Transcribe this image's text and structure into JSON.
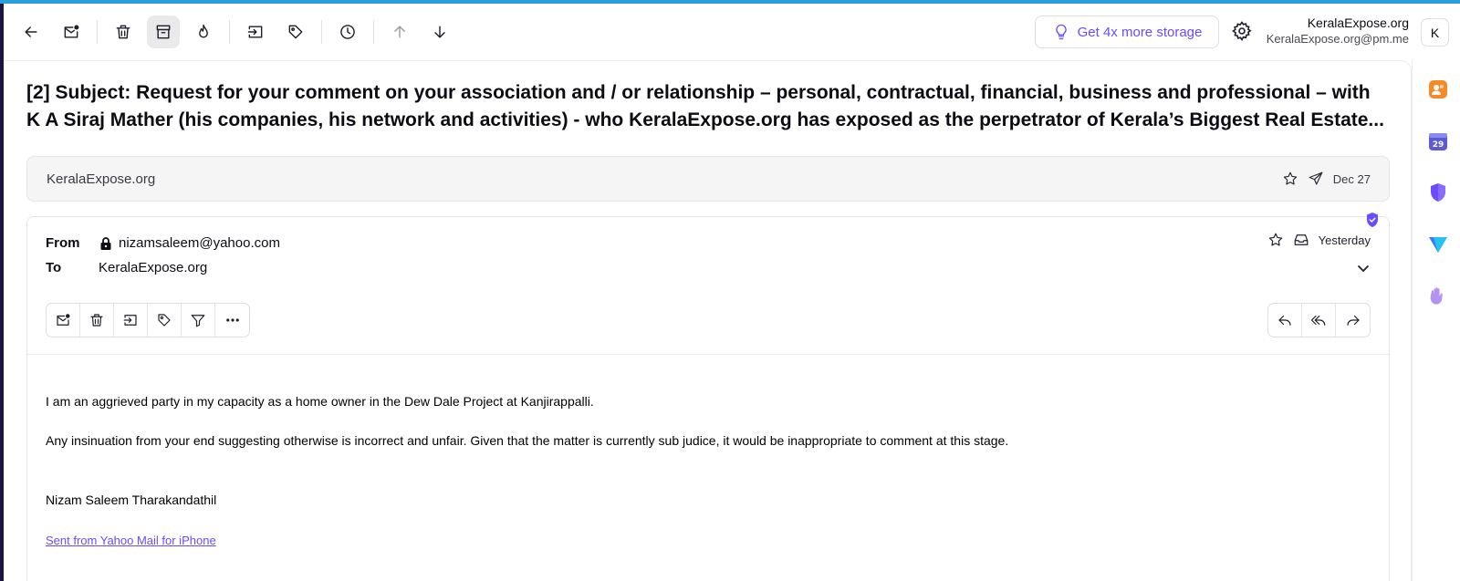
{
  "account": {
    "name": "KeralaExpose.org",
    "email": "KeralaExpose.org@pm.me",
    "avatar_initial": "K"
  },
  "toolbar": {
    "storage_label": "Get 4x more storage",
    "buttons": [
      "back-arrow-icon",
      "mark-unread-icon",
      "trash-icon",
      "archive-icon",
      "spam-flame-icon",
      "move-to-folder-icon",
      "label-tag-icon",
      "snooze-clock-icon",
      "previous-arrow-icon",
      "next-arrow-icon"
    ]
  },
  "subject": "[2] Subject: Request for your comment on your association and / or relationship – personal, contractual, financial, business and professional – with K A Siraj Mather (his companies, his network and activities) - who KeralaExpose.org has exposed as the perpetrator of Kerala’s Biggest Real Estate...",
  "collapsed_message": {
    "sender": "KeralaExpose.org",
    "date": "Dec 27"
  },
  "message": {
    "from_label": "From",
    "from": "nizamsaleem@yahoo.com",
    "to_label": "To",
    "to": "KeralaExpose.org",
    "date": "Yesterday",
    "body": [
      "I am an aggrieved party in my capacity as a home owner in the Dew Dale Project at Kanjirappalli.",
      "Any insinuation from your end suggesting otherwise is incorrect and unfair. Given that the matter is currently sub judice, it would be inappropriate to comment at this stage."
    ],
    "signature": "Nizam Saleem Tharakandathil",
    "sent_from_link": "Sent from Yahoo Mail for iPhone"
  },
  "colors": {
    "accent": "#6d4aff",
    "top_strip": "#2a9ed8"
  }
}
